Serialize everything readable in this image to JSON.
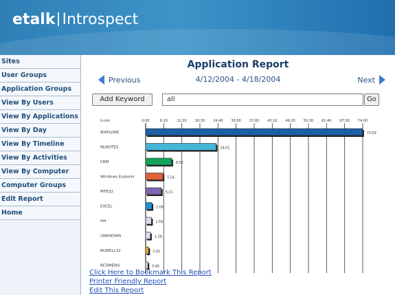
{
  "header": {
    "brand_bold": "etalk",
    "brand_rest": "Introspect"
  },
  "sidebar": {
    "items": [
      "Sites",
      "User Groups",
      "Application Groups",
      "View By Users",
      "View By Applications",
      "View By Day",
      "View By Timeline",
      "View By Activities",
      "View By Computer",
      "Computer Groups",
      "Edit Report",
      "Home"
    ]
  },
  "report": {
    "title": "Application Report",
    "prev_label": "Previous",
    "next_label": "Next",
    "date_range": "4/12/2004 - 4/18/2004",
    "add_keyword_label": "Add Keyword",
    "keyword_value": "all",
    "go_label": "Go"
  },
  "links": {
    "bookmark": "Click Here to Bookmark This Report",
    "printer": "Printer Friendly Report",
    "edit": "Edit This Report"
  },
  "colors": {
    "accent": "#3a7fd0",
    "header": "#2f7fb7"
  },
  "chart_data": {
    "type": "bar",
    "orientation": "horizontal",
    "x_header": "h:min",
    "x_ticks": [
      "0:00",
      "6:10",
      "12:20",
      "18:30",
      "24:40",
      "30:50",
      "37:00",
      "43:10",
      "49:20",
      "55:30",
      "61:40",
      "67:50",
      "74:00"
    ],
    "xlim_minutes": [
      0,
      4440
    ],
    "categories": [
      "IEXPLORE",
      "NLNOTES",
      "CRM",
      "Windows Explorer",
      "MTE32",
      "EXCEL",
      "HH",
      "UNKNOWN",
      "RUNDLL32",
      "RCDMENU"
    ],
    "labels": [
      "73:59",
      "24:01",
      "8:53",
      "5:54",
      "5:21",
      "2:08",
      "1:59",
      "1:38",
      "1:01",
      "0:46"
    ],
    "values_minutes": [
      4439,
      1441,
      533,
      354,
      321,
      128,
      119,
      98,
      61,
      46
    ],
    "bar_colors": [
      "#1d5fa3",
      "#45b5d6",
      "#13a35a",
      "#e2603b",
      "#7d68b0",
      "#1f8fd7",
      "#d9d9ea",
      "#d9d9ea",
      "#e3a52d",
      "#d9d9ea"
    ]
  }
}
